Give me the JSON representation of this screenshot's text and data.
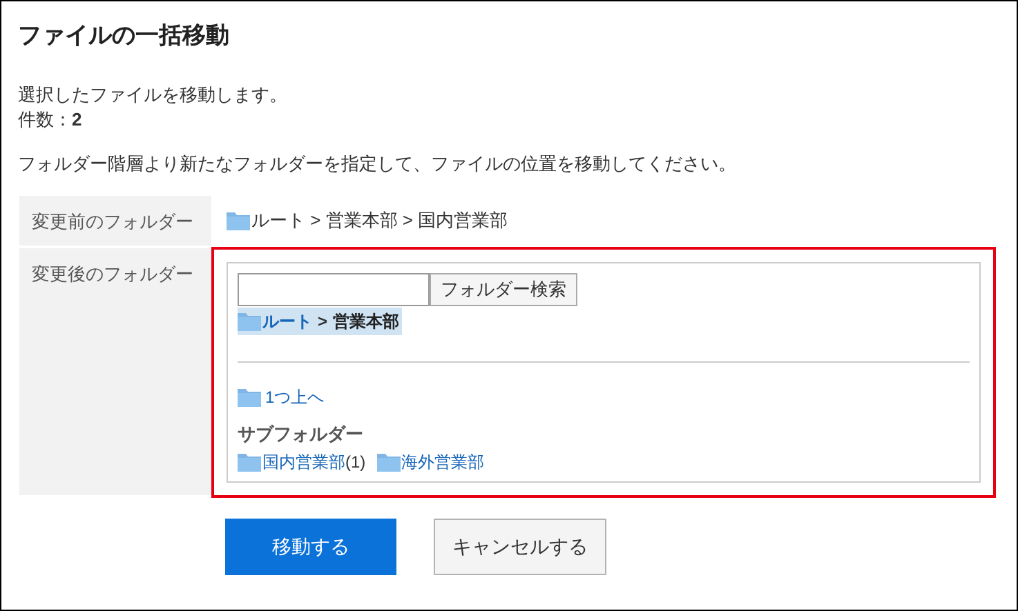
{
  "title": "ファイルの一括移動",
  "description": "選択したファイルを移動します。",
  "count": {
    "label": "件数：",
    "value": "2"
  },
  "instruction": "フォルダー階層より新たなフォルダーを指定して、ファイルの位置を移動してください。",
  "before": {
    "label": "変更前のフォルダー",
    "path": "ルート > 営業本部 > 国内営業部"
  },
  "after": {
    "label": "変更後のフォルダー",
    "search_button": "フォルダー検索",
    "breadcrumb": [
      {
        "name": "ルート",
        "kind": "link"
      },
      {
        "name": "営業本部",
        "kind": "current"
      }
    ],
    "separator": ">",
    "up_link": "1つ上へ",
    "subfolders_heading": "サブフォルダー",
    "subfolders": [
      {
        "name": "国内営業部",
        "count": "(1)"
      },
      {
        "name": "海外営業部"
      }
    ]
  },
  "buttons": [
    {
      "label": "移動する",
      "kind": "primary"
    },
    {
      "label": "キャンセルする",
      "kind": "secondary"
    }
  ]
}
